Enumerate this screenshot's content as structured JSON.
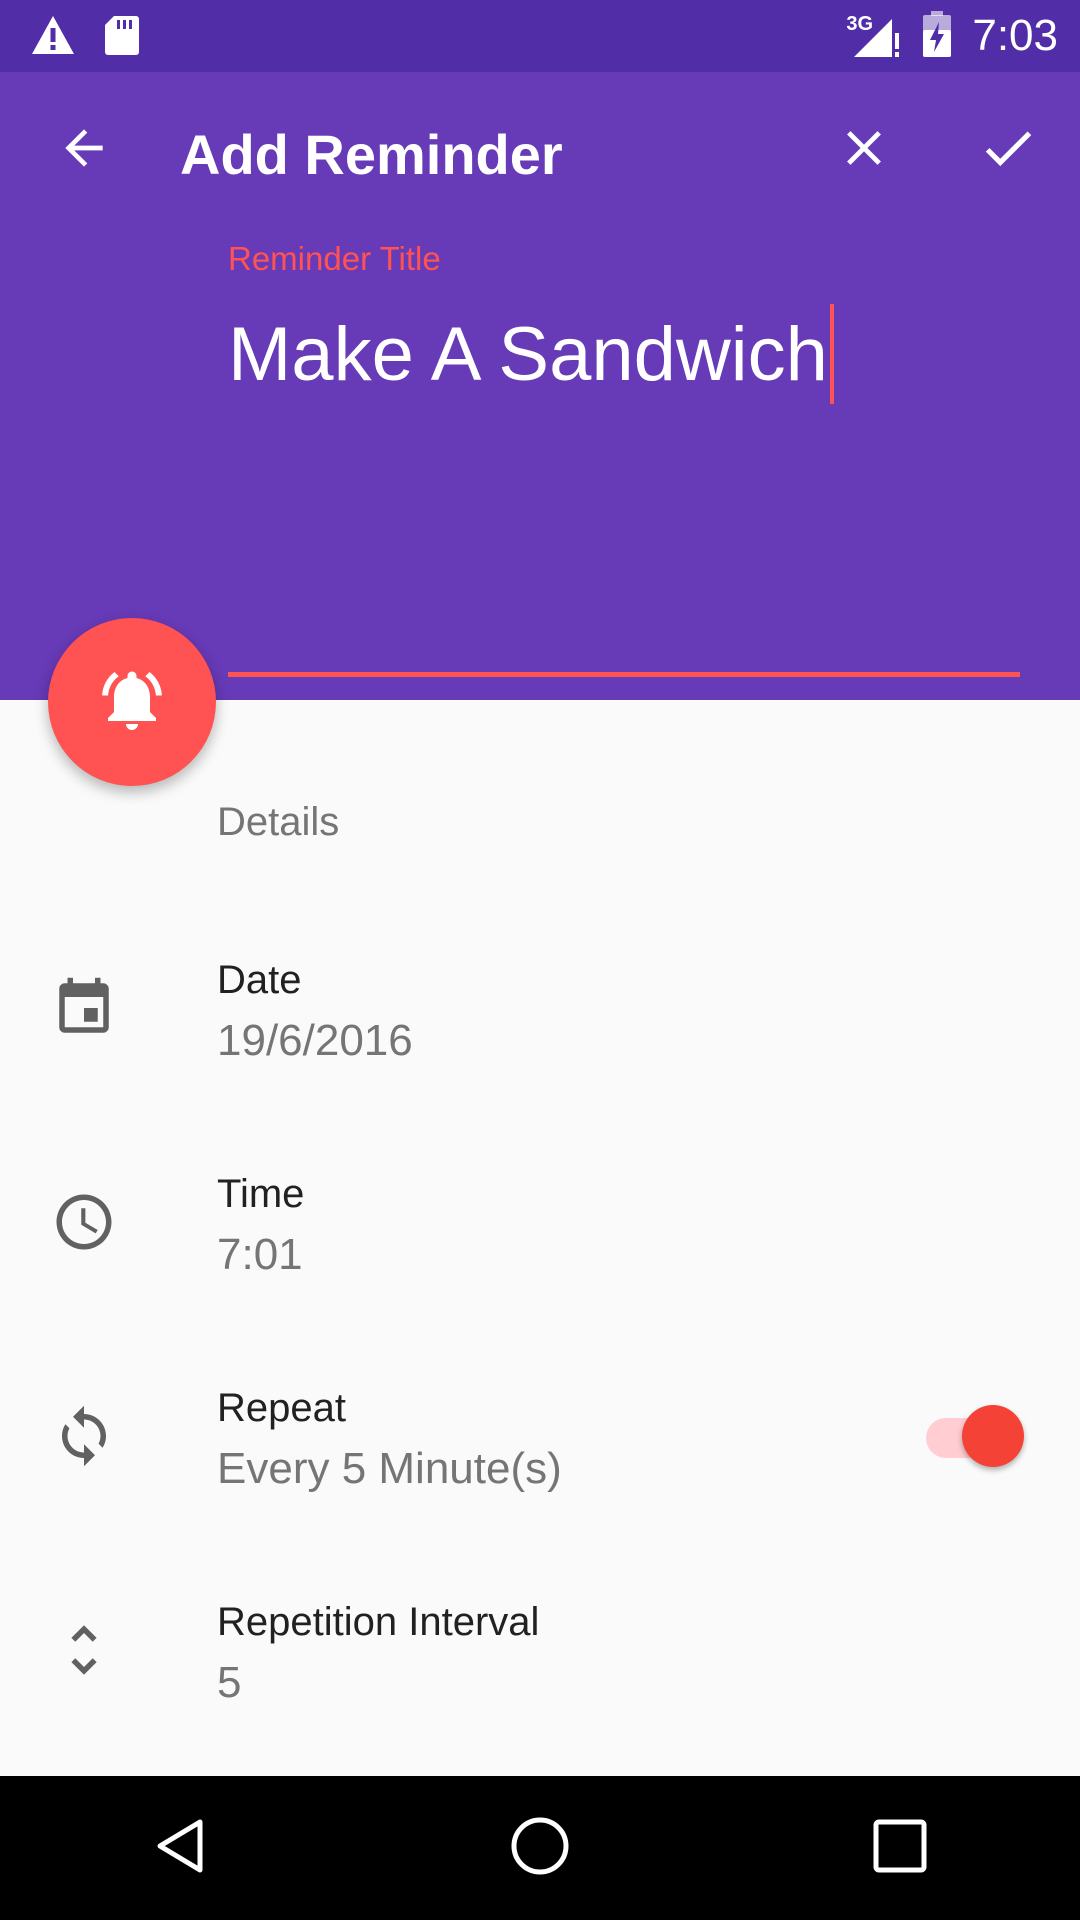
{
  "status_bar": {
    "network": "3G",
    "time": "7:03",
    "icons": [
      "warning-icon",
      "sd-card-icon",
      "signal-icon",
      "battery-icon"
    ]
  },
  "toolbar": {
    "title": "Add Reminder",
    "back_icon": "arrow-back-icon",
    "close_icon": "close-icon",
    "done_icon": "check-icon"
  },
  "reminder_title": {
    "label": "Reminder Title",
    "value": "Make A Sandwich"
  },
  "fab": {
    "icon": "alarm-bell-icon"
  },
  "details": {
    "header": "Details",
    "rows": [
      {
        "icon": "calendar-icon",
        "label": "Date",
        "value": "19/6/2016"
      },
      {
        "icon": "clock-icon",
        "label": "Time",
        "value": "7:01"
      },
      {
        "icon": "repeat-icon",
        "label": "Repeat",
        "value": "Every 5 Minute(s)",
        "toggle_on": true
      },
      {
        "icon": "unfold-icon",
        "label": "Repetition Interval",
        "value": "5"
      }
    ]
  },
  "nav_bar": {
    "icons": [
      "nav-back-icon",
      "nav-home-icon",
      "nav-recents-icon"
    ]
  },
  "colors": {
    "status_bar": "#512DA8",
    "primary": "#673AB7",
    "accent": "#FF5252",
    "background": "#FAFAFA",
    "text_primary": "#212121",
    "text_secondary": "#757575"
  }
}
